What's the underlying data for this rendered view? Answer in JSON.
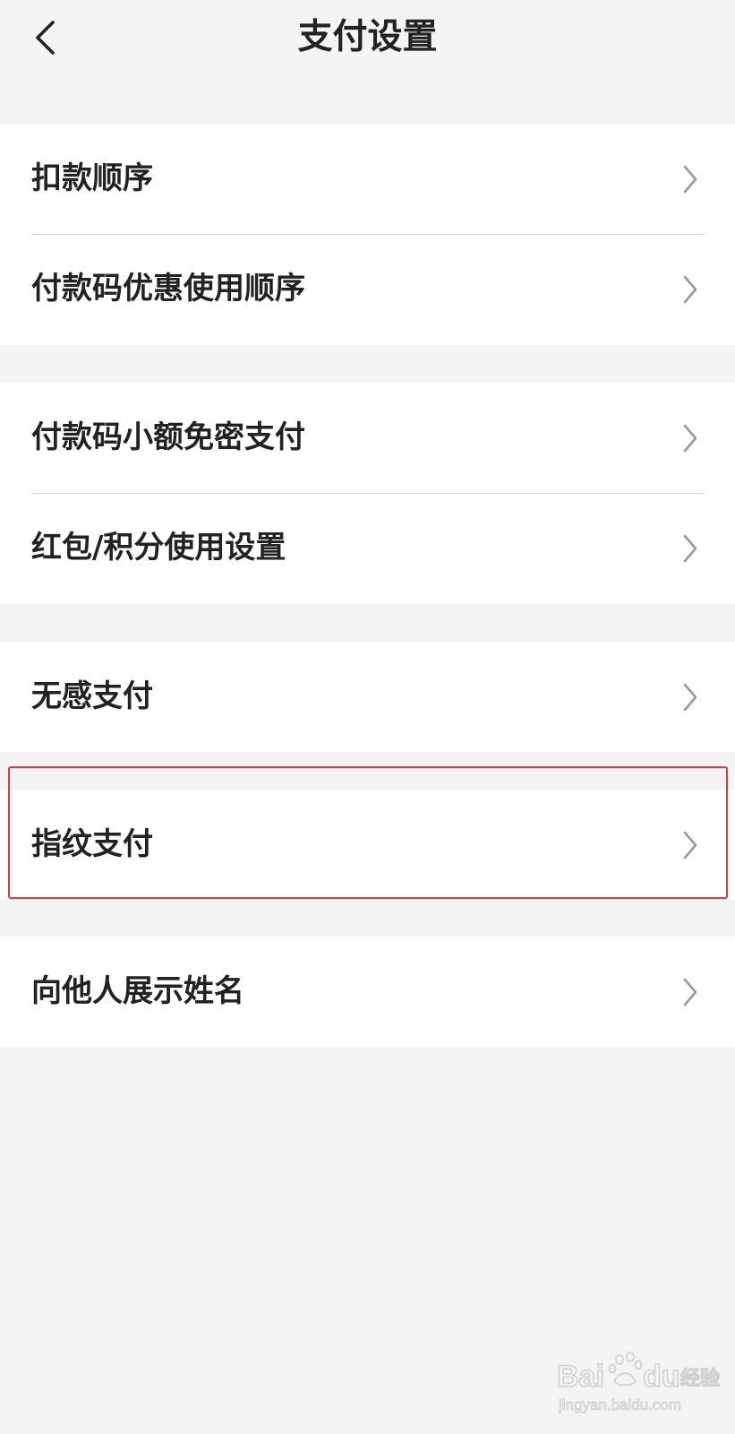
{
  "header": {
    "title": "支付设置",
    "back_icon": "chevron-left-icon"
  },
  "groups": [
    {
      "items": [
        {
          "label": "扣款顺序"
        },
        {
          "label": "付款码优惠使用顺序"
        }
      ]
    },
    {
      "items": [
        {
          "label": "付款码小额免密支付"
        },
        {
          "label": "红包/积分使用设置"
        }
      ]
    },
    {
      "items": [
        {
          "label": "无感支付"
        }
      ]
    },
    {
      "items": [
        {
          "label": "指纹支付",
          "highlighted": true
        }
      ]
    },
    {
      "items": [
        {
          "label": "向他人展示姓名"
        }
      ]
    }
  ],
  "row_icon": "chevron-right-icon",
  "watermark": {
    "brand": "Bai du 经验",
    "url": "jingyan.baidu.com"
  },
  "colors": {
    "background": "#f4f4f4",
    "card": "#ffffff",
    "text": "#222222",
    "chevron": "#999999",
    "divider": "#d9d9d9",
    "highlight": "#e0393e"
  }
}
